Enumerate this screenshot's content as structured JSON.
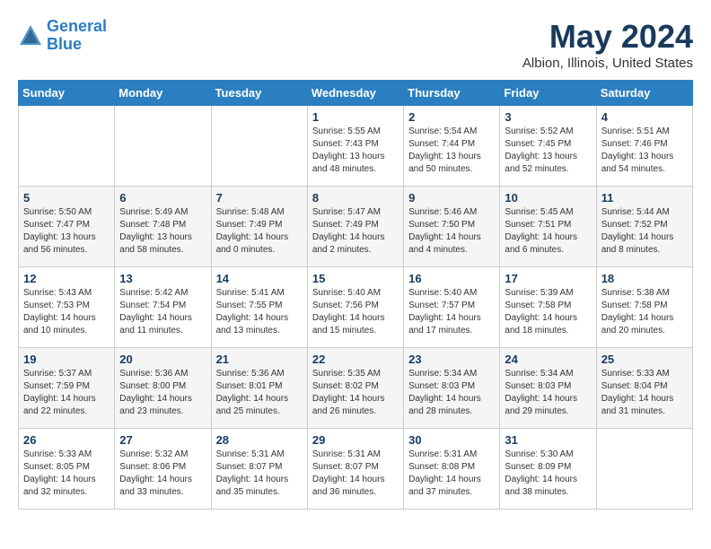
{
  "header": {
    "logo_line1": "General",
    "logo_line2": "Blue",
    "month": "May 2024",
    "location": "Albion, Illinois, United States"
  },
  "weekdays": [
    "Sunday",
    "Monday",
    "Tuesday",
    "Wednesday",
    "Thursday",
    "Friday",
    "Saturday"
  ],
  "weeks": [
    [
      {
        "day": "",
        "info": ""
      },
      {
        "day": "",
        "info": ""
      },
      {
        "day": "",
        "info": ""
      },
      {
        "day": "1",
        "info": "Sunrise: 5:55 AM\nSunset: 7:43 PM\nDaylight: 13 hours\nand 48 minutes."
      },
      {
        "day": "2",
        "info": "Sunrise: 5:54 AM\nSunset: 7:44 PM\nDaylight: 13 hours\nand 50 minutes."
      },
      {
        "day": "3",
        "info": "Sunrise: 5:52 AM\nSunset: 7:45 PM\nDaylight: 13 hours\nand 52 minutes."
      },
      {
        "day": "4",
        "info": "Sunrise: 5:51 AM\nSunset: 7:46 PM\nDaylight: 13 hours\nand 54 minutes."
      }
    ],
    [
      {
        "day": "5",
        "info": "Sunrise: 5:50 AM\nSunset: 7:47 PM\nDaylight: 13 hours\nand 56 minutes."
      },
      {
        "day": "6",
        "info": "Sunrise: 5:49 AM\nSunset: 7:48 PM\nDaylight: 13 hours\nand 58 minutes."
      },
      {
        "day": "7",
        "info": "Sunrise: 5:48 AM\nSunset: 7:49 PM\nDaylight: 14 hours\nand 0 minutes."
      },
      {
        "day": "8",
        "info": "Sunrise: 5:47 AM\nSunset: 7:49 PM\nDaylight: 14 hours\nand 2 minutes."
      },
      {
        "day": "9",
        "info": "Sunrise: 5:46 AM\nSunset: 7:50 PM\nDaylight: 14 hours\nand 4 minutes."
      },
      {
        "day": "10",
        "info": "Sunrise: 5:45 AM\nSunset: 7:51 PM\nDaylight: 14 hours\nand 6 minutes."
      },
      {
        "day": "11",
        "info": "Sunrise: 5:44 AM\nSunset: 7:52 PM\nDaylight: 14 hours\nand 8 minutes."
      }
    ],
    [
      {
        "day": "12",
        "info": "Sunrise: 5:43 AM\nSunset: 7:53 PM\nDaylight: 14 hours\nand 10 minutes."
      },
      {
        "day": "13",
        "info": "Sunrise: 5:42 AM\nSunset: 7:54 PM\nDaylight: 14 hours\nand 11 minutes."
      },
      {
        "day": "14",
        "info": "Sunrise: 5:41 AM\nSunset: 7:55 PM\nDaylight: 14 hours\nand 13 minutes."
      },
      {
        "day": "15",
        "info": "Sunrise: 5:40 AM\nSunset: 7:56 PM\nDaylight: 14 hours\nand 15 minutes."
      },
      {
        "day": "16",
        "info": "Sunrise: 5:40 AM\nSunset: 7:57 PM\nDaylight: 14 hours\nand 17 minutes."
      },
      {
        "day": "17",
        "info": "Sunrise: 5:39 AM\nSunset: 7:58 PM\nDaylight: 14 hours\nand 18 minutes."
      },
      {
        "day": "18",
        "info": "Sunrise: 5:38 AM\nSunset: 7:58 PM\nDaylight: 14 hours\nand 20 minutes."
      }
    ],
    [
      {
        "day": "19",
        "info": "Sunrise: 5:37 AM\nSunset: 7:59 PM\nDaylight: 14 hours\nand 22 minutes."
      },
      {
        "day": "20",
        "info": "Sunrise: 5:36 AM\nSunset: 8:00 PM\nDaylight: 14 hours\nand 23 minutes."
      },
      {
        "day": "21",
        "info": "Sunrise: 5:36 AM\nSunset: 8:01 PM\nDaylight: 14 hours\nand 25 minutes."
      },
      {
        "day": "22",
        "info": "Sunrise: 5:35 AM\nSunset: 8:02 PM\nDaylight: 14 hours\nand 26 minutes."
      },
      {
        "day": "23",
        "info": "Sunrise: 5:34 AM\nSunset: 8:03 PM\nDaylight: 14 hours\nand 28 minutes."
      },
      {
        "day": "24",
        "info": "Sunrise: 5:34 AM\nSunset: 8:03 PM\nDaylight: 14 hours\nand 29 minutes."
      },
      {
        "day": "25",
        "info": "Sunrise: 5:33 AM\nSunset: 8:04 PM\nDaylight: 14 hours\nand 31 minutes."
      }
    ],
    [
      {
        "day": "26",
        "info": "Sunrise: 5:33 AM\nSunset: 8:05 PM\nDaylight: 14 hours\nand 32 minutes."
      },
      {
        "day": "27",
        "info": "Sunrise: 5:32 AM\nSunset: 8:06 PM\nDaylight: 14 hours\nand 33 minutes."
      },
      {
        "day": "28",
        "info": "Sunrise: 5:31 AM\nSunset: 8:07 PM\nDaylight: 14 hours\nand 35 minutes."
      },
      {
        "day": "29",
        "info": "Sunrise: 5:31 AM\nSunset: 8:07 PM\nDaylight: 14 hours\nand 36 minutes."
      },
      {
        "day": "30",
        "info": "Sunrise: 5:31 AM\nSunset: 8:08 PM\nDaylight: 14 hours\nand 37 minutes."
      },
      {
        "day": "31",
        "info": "Sunrise: 5:30 AM\nSunset: 8:09 PM\nDaylight: 14 hours\nand 38 minutes."
      },
      {
        "day": "",
        "info": ""
      }
    ]
  ]
}
